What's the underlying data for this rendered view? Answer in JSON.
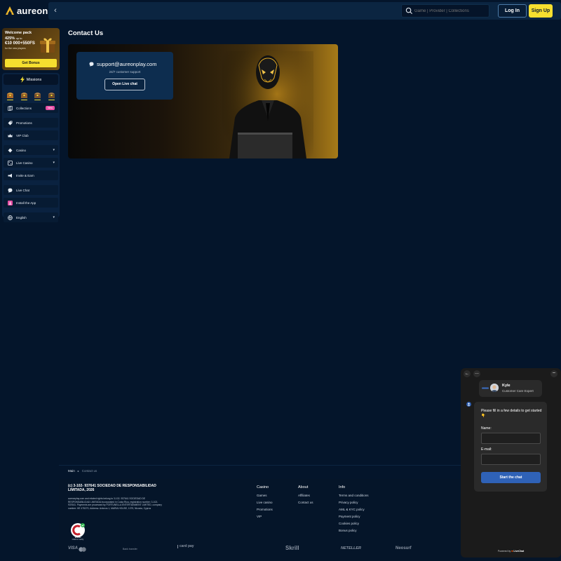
{
  "header": {
    "logo_text": "aureon",
    "search_placeholder": "Game | Provider | Collections",
    "login_label": "Log In",
    "signup_label": "Sign Up"
  },
  "sidebar": {
    "welcome": {
      "line1": "Welcome pack",
      "line2": "425%",
      "line2_suffix": "up to",
      "line3": "€10 000+550FS",
      "line4": "for the new players",
      "button": "Get Bonus"
    },
    "missions_label": "Missions",
    "items": [
      {
        "label": "Collections",
        "icon": "cards-icon",
        "badge": "New"
      },
      {
        "label": "Promotions",
        "icon": "tag-icon"
      },
      {
        "label": "VIP Club",
        "icon": "crown-icon"
      },
      {
        "label": "Casino",
        "icon": "casino-chip-icon"
      },
      {
        "label": "Live Casino",
        "icon": "live-casino-icon"
      },
      {
        "label": "Invite & Earn",
        "icon": "megaphone-icon"
      },
      {
        "label": "Live Chat",
        "icon": "chat-icon"
      },
      {
        "label": "Install the App",
        "icon": "download-icon"
      },
      {
        "label": "English",
        "icon": "globe-icon"
      }
    ]
  },
  "main": {
    "title": "Contact Us",
    "email": "support@aureonplay.com",
    "support_text": "24/7 customer support",
    "open_chat_label": "Open Live chat"
  },
  "breadcrumb": {
    "home": "Main",
    "current": "Contact us"
  },
  "footer": {
    "legal_title": "(c) 3-102- 937641 SOCIEDAD DE RESPONSABILIDAD LIMITADA, 2026",
    "legal_body": "aureonplay.com and related rights belong to 3-102- 937641 SOCIEDAD DE RESPONSABILIDAD LIMITADA incorporated in Costa Rica, registration number: 3-102- 937641. Payments are processed by FORTUNELLA ENTERTAINMENT LIMITED, company number: HE 475270, Address: Avlonos 1, MARIA HOUSE, 1075, Nicosia, Cyprus",
    "seal_text": "VALID",
    "seal_sub": "Click to verify",
    "columns": [
      {
        "heading": "Casino",
        "links": [
          "Games",
          "Live casino",
          "Promotions",
          "VIP"
        ]
      },
      {
        "heading": "About",
        "links": [
          "Affiliates",
          "Contact us"
        ]
      },
      {
        "heading": "Info",
        "links": [
          "Terms and conditions",
          "Privacy policy",
          "AML & KYC policy",
          "Payment policy",
          "Cookies policy",
          "Bonus policy"
        ]
      }
    ],
    "payments": [
      "VISA",
      "Bank transfer",
      "card pay",
      "Skrill",
      "NETELLER",
      "Neosurf"
    ]
  },
  "chat": {
    "agent_name": "Kyle",
    "agent_role": "Customer Care Expert",
    "intro": "Please fill in a few details to get started 👇",
    "name_label": "Name:",
    "email_label": "E-mail:",
    "start_label": "Start the chat",
    "powered_prefix": "Powered by",
    "powered_brand": "LiveChat"
  },
  "colors": {
    "background": "#04152b",
    "accent_yellow": "#f6df2f",
    "chat_blue": "#2f62b7"
  }
}
